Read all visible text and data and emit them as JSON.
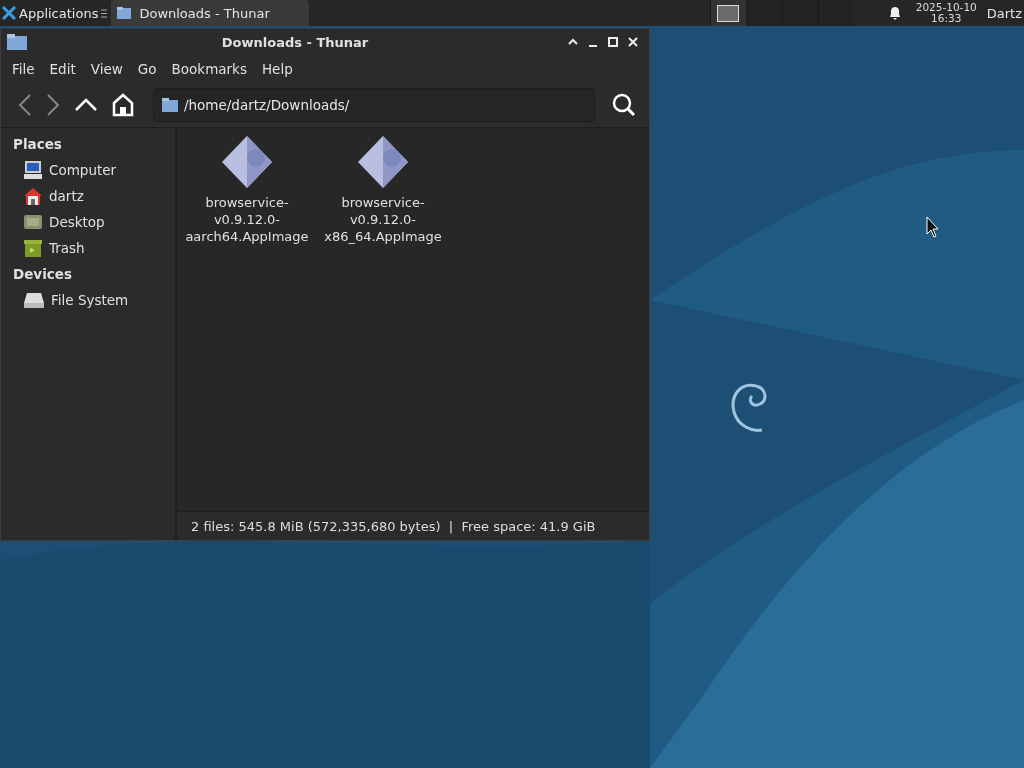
{
  "panel": {
    "menu_label": "Applications",
    "tasks": [
      {
        "label": "Downloads - Thunar",
        "selected": true
      }
    ],
    "workspaces": [
      {
        "selected": true
      },
      {
        "selected": false
      },
      {
        "selected": false
      },
      {
        "selected": false
      }
    ],
    "clock": {
      "date": "2025-10-10",
      "time": "16:33"
    },
    "user": "Dartz"
  },
  "window": {
    "title": "Downloads - Thunar",
    "menu": [
      "File",
      "Edit",
      "View",
      "Go",
      "Bookmarks",
      "Help"
    ],
    "location": "/home/dartz/Downloads/",
    "sidebar": [
      {
        "heading": "Places",
        "items": [
          {
            "label": "Computer",
            "kind": "computer"
          },
          {
            "label": "dartz",
            "kind": "home"
          },
          {
            "label": "Desktop",
            "kind": "desktop"
          },
          {
            "label": "Trash",
            "kind": "trash"
          }
        ]
      },
      {
        "heading": "Devices",
        "items": [
          {
            "label": "File System",
            "kind": "drive"
          }
        ]
      }
    ],
    "files": [
      {
        "name": "browservice-v0.9.12.0-aarch64.AppImage"
      },
      {
        "name": "browservice-v0.9.12.0-x86_64.AppImage"
      }
    ],
    "status": "2 files: 545.8 MiB (572,335,680 bytes)  |  Free space: 41.9 GiB"
  }
}
